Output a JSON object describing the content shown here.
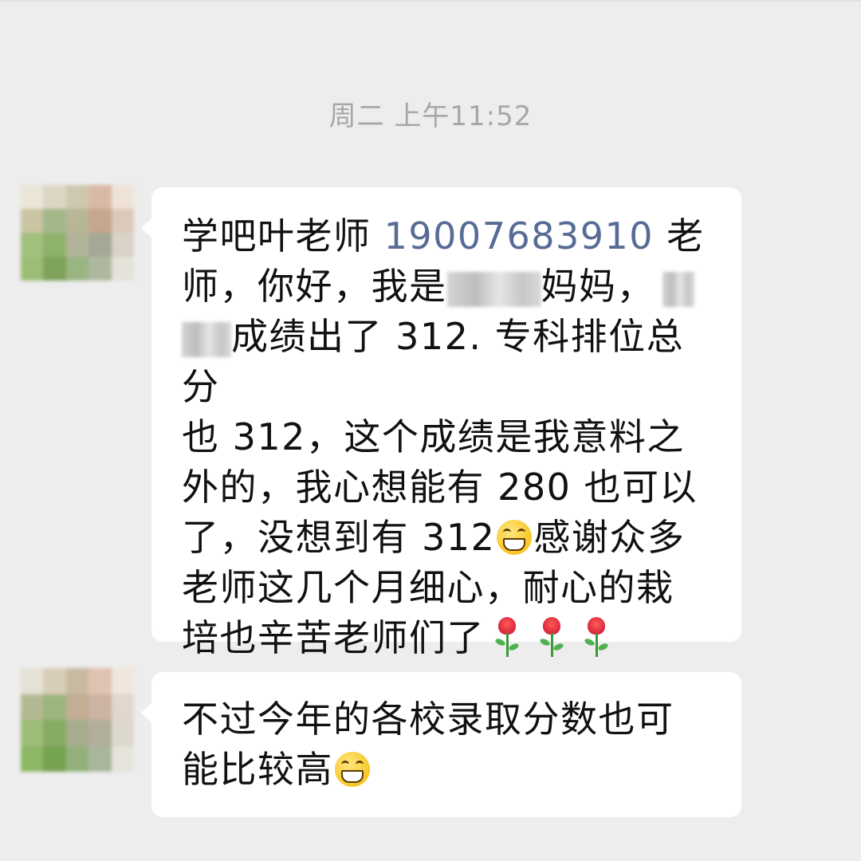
{
  "chat": {
    "timestamp": "周二 上午11:52",
    "messages": [
      {
        "line1_pre": "学吧叶老师 ",
        "phone": "19007683910",
        "line1_post": " 老",
        "line2_pre": "师，你好，我是",
        "line2_post": "妈妈，",
        "line3_post": "成绩出了 312. 专科排位总分",
        "line4": "也 312，这个成绩是我意料之",
        "line5": "外的，我心想能有 280 也可以",
        "line6_pre": "了，没想到有 312",
        "line6_post": "感谢众多",
        "line7": "老师这几个月细心，耐心的栽",
        "line8": "培也辛苦老师们了"
      },
      {
        "line1": "不过今年的各校录取分数也可",
        "line2": "能比较高"
      }
    ]
  },
  "icons": {
    "grin": "grinning-face-icon",
    "rose": "rose-icon",
    "avatar": "blurred-avatar"
  },
  "colors": {
    "background": "#ededed",
    "bubble": "#ffffff",
    "link": "#576b95",
    "timestamp": "#a7a7a7"
  }
}
